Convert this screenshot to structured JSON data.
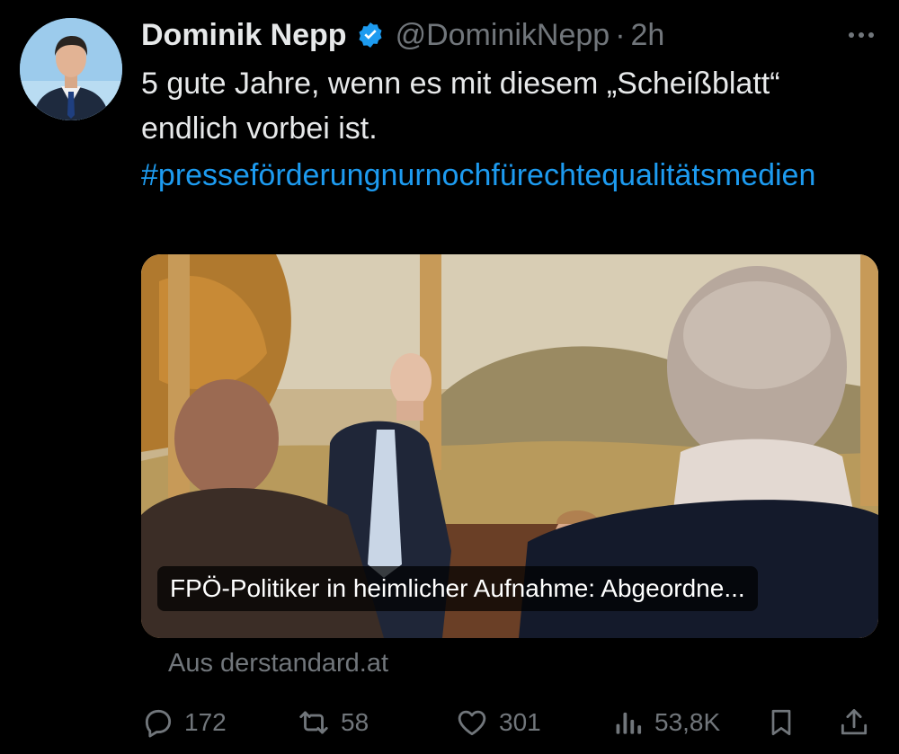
{
  "tweet": {
    "author_name": "Dominik Nepp",
    "handle": "@DominikNepp",
    "separator": "·",
    "time": "2h",
    "text_line1": "5 gute Jahre, wenn es mit diesem „Scheißblatt“",
    "text_line2": "endlich vorbei ist.",
    "hashtag": "#presseförderungnurnochfürechtequalitätsmedien"
  },
  "link_card": {
    "caption": "FPÖ-Politiker in heimlicher Aufnahme: Abgeordne...",
    "source": "Aus derstandard.at"
  },
  "actions": {
    "replies": "172",
    "retweets": "58",
    "likes": "301",
    "views": "53,8K"
  },
  "icons": {
    "verified": "verified-badge-icon",
    "more": "more-dots-icon",
    "reply": "reply-icon",
    "retweet": "retweet-icon",
    "like": "heart-icon",
    "views": "views-icon",
    "bookmark": "bookmark-icon",
    "share": "share-icon"
  },
  "colors": {
    "background": "#000000",
    "text": "#e7e9ea",
    "muted": "#71767b",
    "link": "#1d9bf0"
  }
}
